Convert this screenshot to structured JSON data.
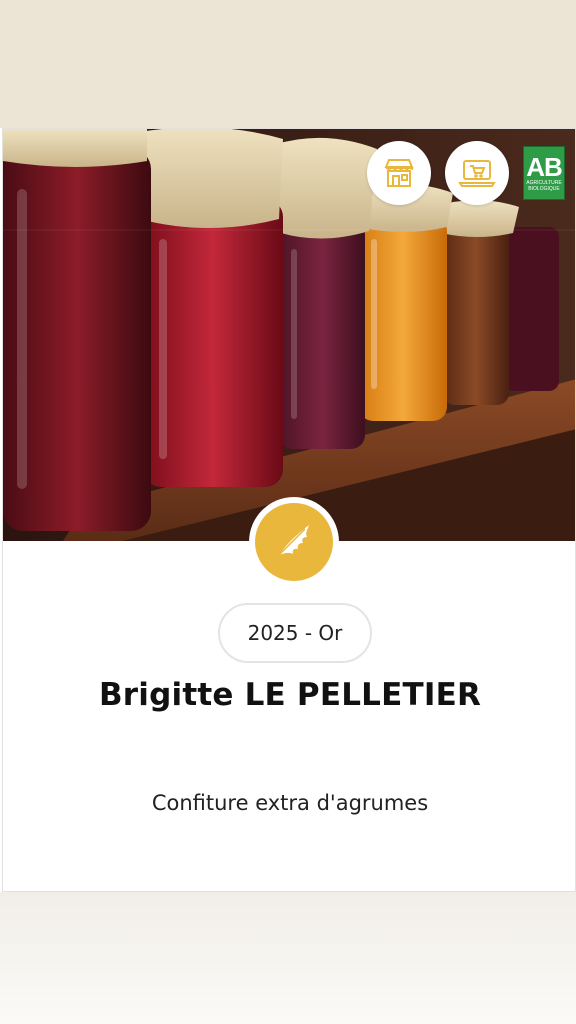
{
  "award": {
    "label": "2025 - Or"
  },
  "producer": {
    "name": "Brigitte LE PELLETIER"
  },
  "product": {
    "name": "Confiture extra d'agrumes"
  },
  "badges": {
    "store_icon": "store-icon",
    "online_shop_icon": "laptop-cart-icon",
    "organic_logo": {
      "letters": "AB",
      "caption": "AGRICULTURE BIOLOGIQUE"
    }
  },
  "medal_icon": "oak-leaf-icon",
  "colors": {
    "gold": "#e9b73c",
    "organic_green": "#2e9b46",
    "top_band": "#ece4d4"
  }
}
